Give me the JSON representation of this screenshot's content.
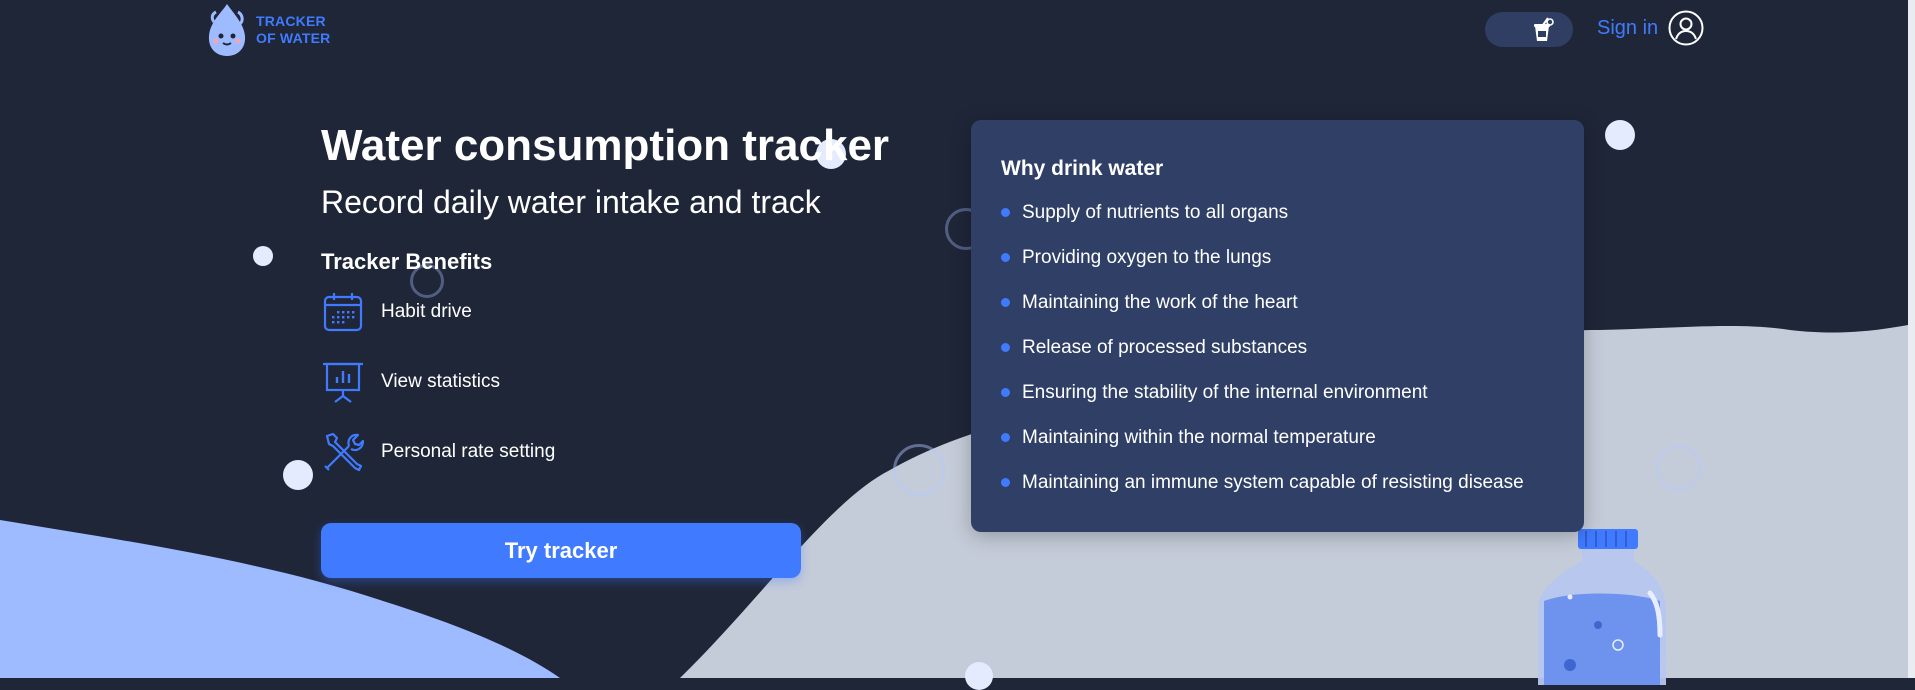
{
  "header": {
    "logo_line1": "TRACKER",
    "logo_line2": "OF WATER",
    "signin_label": "Sign in"
  },
  "hero": {
    "title": "Water consumption tracker",
    "subtitle": "Record daily water intake and track",
    "benefits_title": "Tracker Benefits",
    "benefits": [
      {
        "label": "Habit drive",
        "icon": "calendar-icon"
      },
      {
        "label": "View statistics",
        "icon": "presentation-chart-icon"
      },
      {
        "label": "Personal rate setting",
        "icon": "tools-icon"
      }
    ],
    "cta_label": "Try tracker"
  },
  "why_card": {
    "title": "Why drink water",
    "items": [
      "Supply of nutrients to all organs",
      "Providing oxygen to the lungs",
      "Maintaining the work of the heart",
      "Release of processed substances",
      "Ensuring the stability of the internal environment",
      "Maintaining within the normal temperature",
      "Maintaining an immune system capable of resisting disease"
    ]
  },
  "colors": {
    "background": "#1f2638",
    "accent": "#407bff",
    "card": "#2f3f66",
    "wave_light": "#c5ccd9",
    "wave_blue": "#9ebbff"
  }
}
